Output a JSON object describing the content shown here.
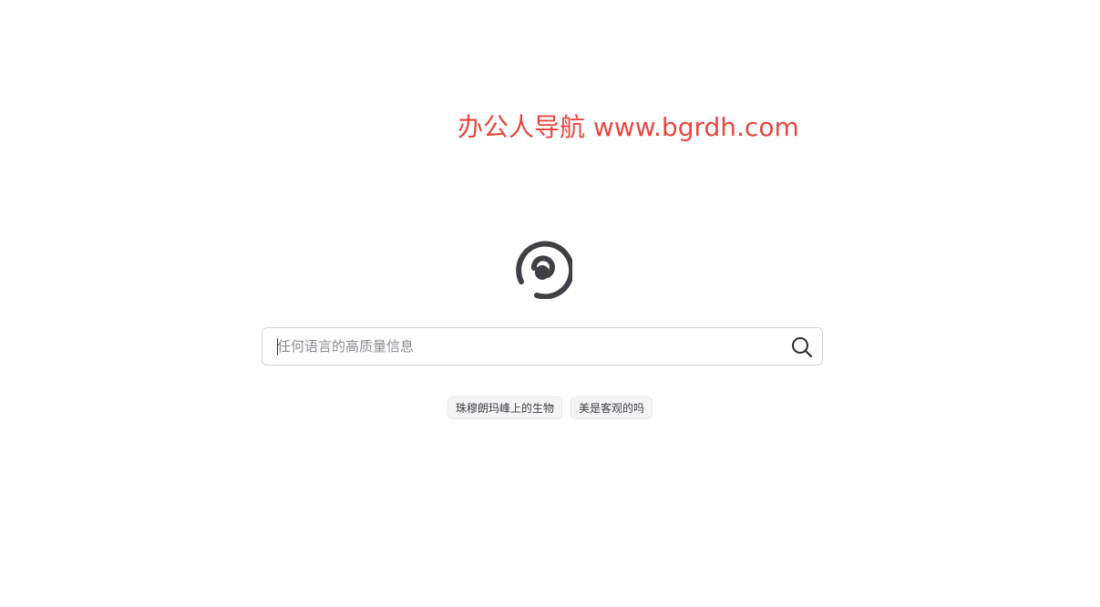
{
  "watermark": {
    "text": "办公人导航 www.bgrdh.com",
    "color": "#e8473f"
  },
  "logo": {
    "icon": "radio-signal-logo-icon",
    "color": "#3f3f46"
  },
  "search": {
    "placeholder": "任何语言的高质量信息",
    "value": "",
    "submit_icon": "search-icon"
  },
  "suggestions": [
    {
      "label": "珠穆朗玛峰上的生物"
    },
    {
      "label": "美是客观的吗"
    }
  ]
}
